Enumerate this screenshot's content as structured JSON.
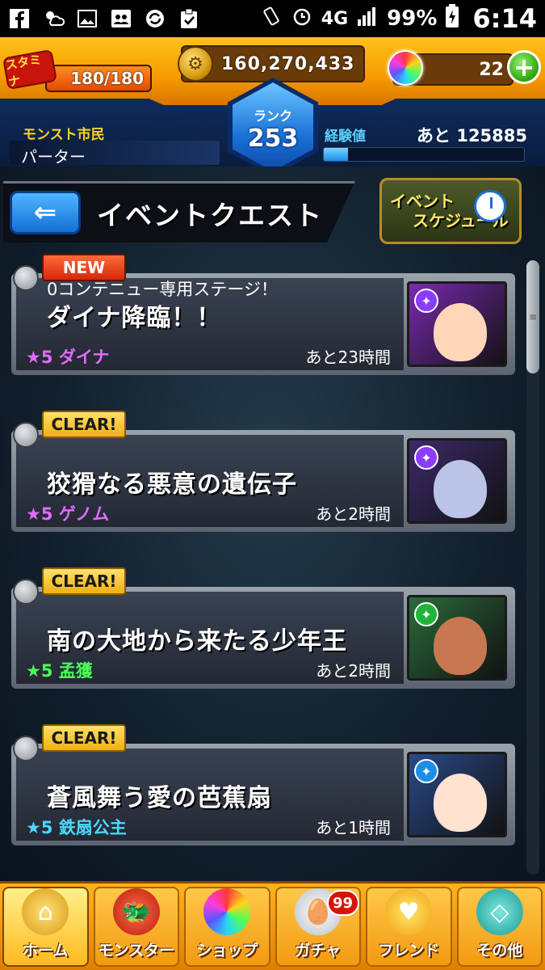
{
  "status_bar": {
    "battery_percent": "99%",
    "network": "4G",
    "time": "6:14",
    "icons": [
      "facebook-icon",
      "weather-icon",
      "gallery-icon",
      "contacts-icon",
      "sync-icon",
      "clipboard-icon"
    ]
  },
  "hud": {
    "stamina_label": "スタミナ",
    "stamina_value": "180/180",
    "stamina_fraction": 1.0,
    "coins": "160,270,433",
    "orbs": "22",
    "plus_label": "+",
    "rank_label": "ランク",
    "rank_value": "253",
    "title_label": "モンスト市民",
    "player_name": "パーター",
    "exp_label": "経験値",
    "exp_remaining": "あと 125885",
    "exp_fraction": 0.12
  },
  "screen": {
    "title": "イベントクエスト",
    "back_icon": "back-arrow-icon",
    "schedule_line1": "イベント",
    "schedule_line2": "スケジュール"
  },
  "quests": [
    {
      "badge": "NEW",
      "badge_type": "new",
      "subtitle": "0コンテニュー専用ステージ！",
      "title": "ダイナ降臨！！",
      "star": "★5 ダイナ",
      "star_color": "#e06cff",
      "time": "あと23時間",
      "thumb_bg": "#7a2ab0",
      "thumb_face": "#ffd7b8",
      "element_color": "#8a3cff"
    },
    {
      "badge": "CLEAR!",
      "badge_type": "clear",
      "subtitle": "",
      "title": "狡猾なる悪意の遺伝子",
      "star": "★5 ゲノム",
      "star_color": "#e06cff",
      "time": "あと2時間",
      "thumb_bg": "#3b2a6b",
      "thumb_face": "#b9c4e6",
      "element_color": "#8a3cff"
    },
    {
      "badge": "CLEAR!",
      "badge_type": "clear",
      "subtitle": "",
      "title": "南の大地から来たる少年王",
      "star": "★5 孟獲",
      "star_color": "#4cff5a",
      "time": "あと2時間",
      "thumb_bg": "#2a6b3b",
      "thumb_face": "#c87850",
      "element_color": "#22b43a"
    },
    {
      "badge": "CLEAR!",
      "badge_type": "clear",
      "subtitle": "",
      "title": "蒼風舞う愛の芭蕉扇",
      "star": "★5 鉄扇公主",
      "star_color": "#4ad8ff",
      "time": "あと1時間",
      "thumb_bg": "#2a4a8b",
      "thumb_face": "#ffe2d0",
      "element_color": "#1d8ee8"
    }
  ],
  "bottom_nav": [
    {
      "label": "ホーム",
      "icon": "home-icon",
      "active": true
    },
    {
      "label": "モンスター",
      "icon": "monster-icon",
      "active": false
    },
    {
      "label": "ショップ",
      "icon": "orb-shop-icon",
      "active": false
    },
    {
      "label": "ガチャ",
      "icon": "gacha-egg-icon",
      "active": false,
      "badge": "99"
    },
    {
      "label": "フレンド",
      "icon": "friend-icon",
      "active": false
    },
    {
      "label": "その他",
      "icon": "other-icon",
      "active": false
    }
  ]
}
